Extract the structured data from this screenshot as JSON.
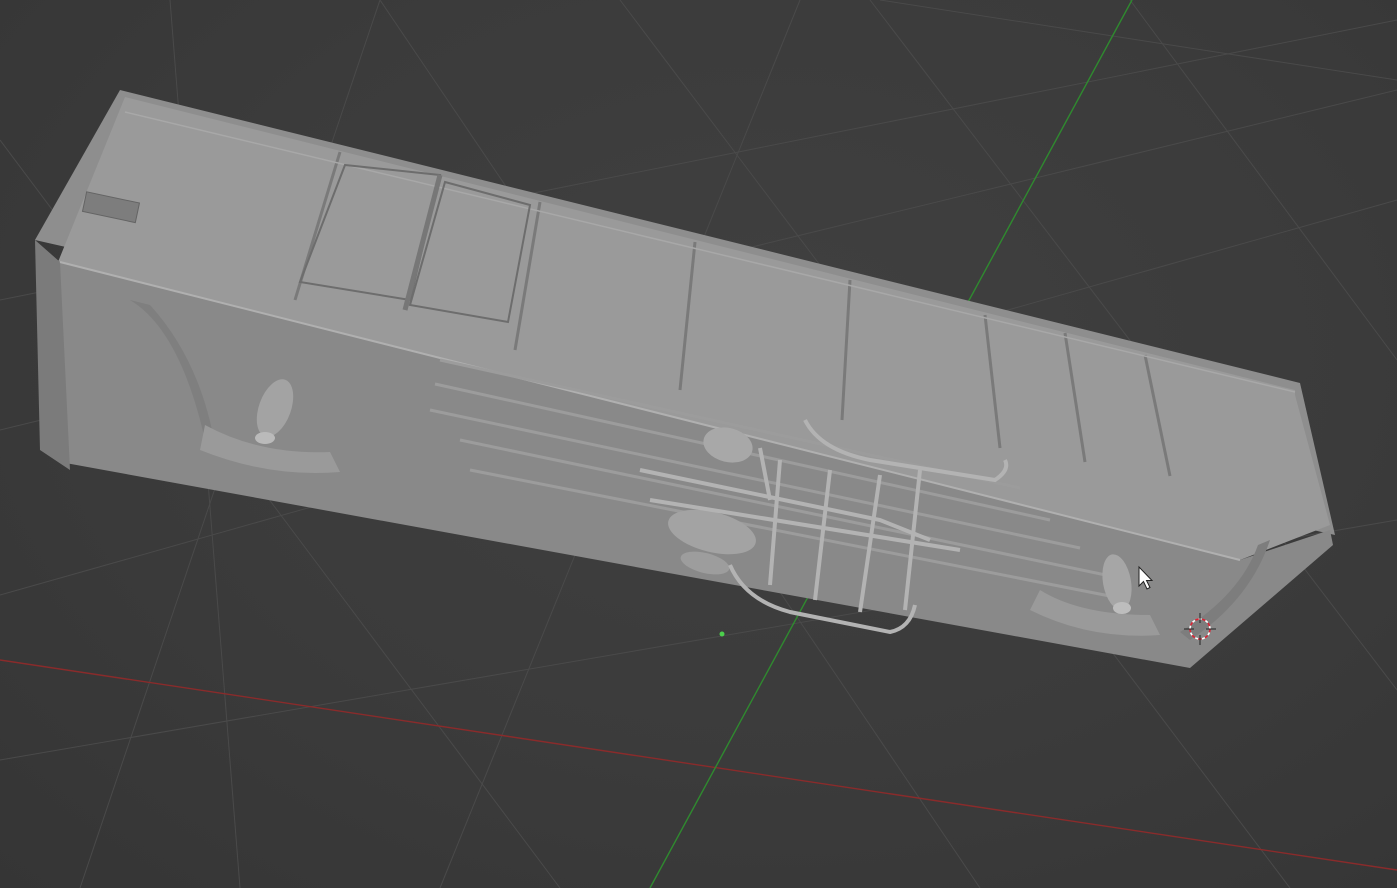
{
  "app": {
    "name": "3D viewport"
  },
  "viewport": {
    "background_color": "#3d3d3d",
    "grid_color": "#4a4a4a",
    "x_axis_color": "#8a2b2b",
    "y_axis_color": "#2f8a2f",
    "model_base_color": "#8c8c8c",
    "model_shadow_color": "#6e6e6e",
    "model_highlight_color": "#a5a5a5"
  },
  "scene": {
    "object_type": "railcar-body-mesh",
    "cursor_icon": "mouse-arrow-icon",
    "origin_icon": "3d-cursor-icon",
    "object_origin_icon": "object-origin-dot-icon"
  }
}
